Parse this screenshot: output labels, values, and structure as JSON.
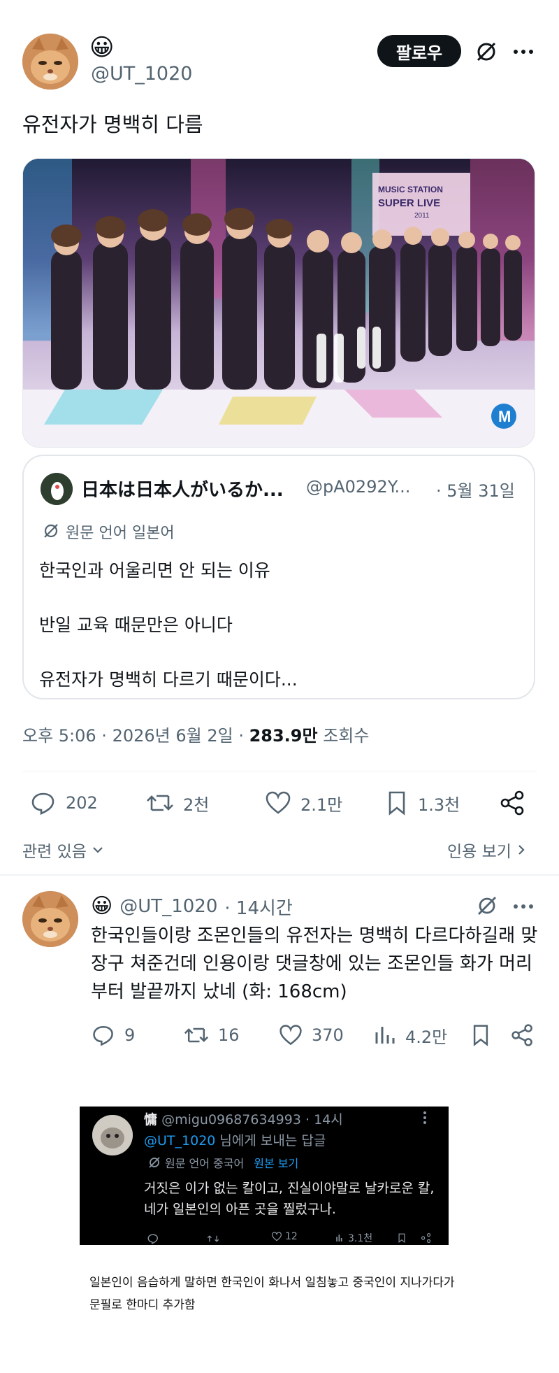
{
  "post": {
    "emoji": "😀",
    "handle": "@UT_1020",
    "follow_label": "팔로우",
    "text": "유전자가 명백히 다름"
  },
  "quote": {
    "name": "日本は日本人がいるか...",
    "handle": "@pA0292Y...",
    "date": "· 5월 31일",
    "translate_note": "원문 언어 일본어",
    "lines": [
      "한국인과 어울리면 안 되는 이유",
      "반일 교육 때문만은 아니다",
      "유전자가 명백히 다르기 때문이다..."
    ]
  },
  "meta": {
    "time": "오후 5:06 · 2026년 6월 2일 · ",
    "views": "283.9만",
    "views_label": " 조회수"
  },
  "actions": {
    "replies": "202",
    "retweets": "2천",
    "likes": "2.1만",
    "bookmarks": "1.3천"
  },
  "related": {
    "label": "관련 있음",
    "quotes_label": "인용 보기"
  },
  "reply": {
    "emoji": "😀",
    "handle": "@UT_1020",
    "time": "· 14시간",
    "text": "한국인들이랑 조몬인들의 유전자는 명백히 다르다하길래 맞장구 쳐준건데 인용이랑 댓글창에 있는 조몬인들 화가 머리부터 발끝까지 났네 (화: 168cm)",
    "replies": "9",
    "retweets": "16",
    "likes": "370",
    "views": "4.2만"
  },
  "screenshot": {
    "name": "慵",
    "handle": "@migu09687634993",
    "time": "· 14시",
    "reply_to_handle": "@UT_1020",
    "reply_to_suffix": " 님에게 보내는 답글",
    "translate_note": "원문 언어 중국어",
    "original_link": "원본 보기",
    "text": "거짓은 이가 없는 칼이고, 진실이야말로 날카로운 칼, 네가 일본인의 아픈 곳을 찔렀구나.",
    "likes": "12",
    "views": "3.1천"
  },
  "caption": {
    "line1": "일본인이 음습하게 말하면 한국인이 화나서 일침놓고 중국인이 지나가다가",
    "line2": "문필로 한마디 추가함"
  },
  "media_logo": {
    "music_station": "MUSIC STATION",
    "super_live": "SUPER LIVE",
    "year": "2011",
    "m": "M"
  },
  "colors": {
    "text": "#0f1419",
    "muted": "#536471",
    "link": "#1d9bf0",
    "follow_bg": "#0f1419"
  }
}
